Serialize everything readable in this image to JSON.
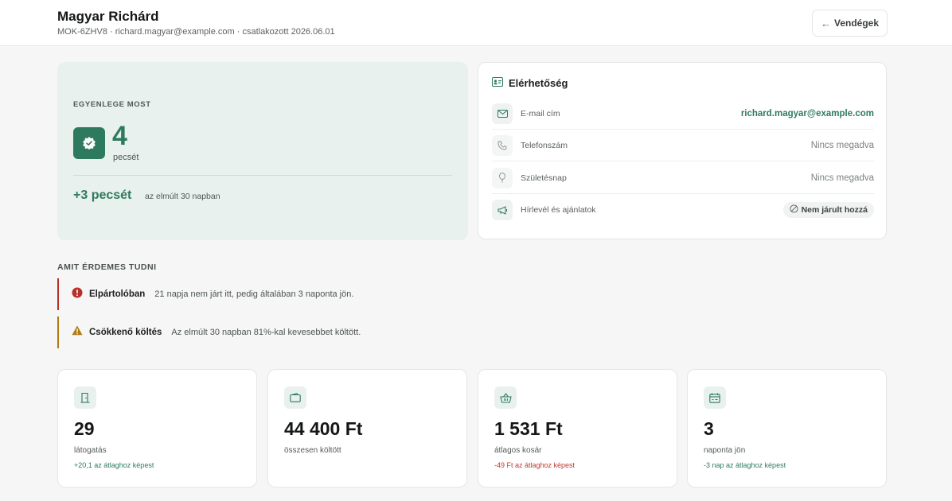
{
  "header": {
    "name": "Magyar Richárd",
    "meta": "MOK-6ZHV8 · richard.magyar@example.com · csatlakozott 2026.06.01",
    "back_label": "Vendégek"
  },
  "balance": {
    "label": "EGYENLEGE MOST",
    "value": "4",
    "unit": "pecsét",
    "gain": "+3 pecsét",
    "gain_note": "az elmúlt 30 napban"
  },
  "contact": {
    "title": "Elérhetőség",
    "rows": [
      {
        "label": "E-mail cím",
        "value": "richard.magyar@example.com",
        "icon": "mail-icon"
      },
      {
        "label": "Telefonszám",
        "value": "Nincs megadva",
        "icon": "phone-icon"
      },
      {
        "label": "Születésnap",
        "value": "Nincs megadva",
        "icon": "balloon-icon"
      },
      {
        "label": "Hírlevél és ajánlatok",
        "value": "Nem járult hozzá",
        "icon": "megaphone-icon"
      }
    ]
  },
  "insights": {
    "label": "AMIT ÉRDEMES TUDNI",
    "items": [
      {
        "title": "Elpártolóban",
        "text": "21 napja nem járt itt, pedig általában 3 naponta jön.",
        "color": "#b8302a"
      },
      {
        "title": "Csökkenő költés",
        "text": "Az elmúlt 30 napban 81%-kal kevesebbet költött.",
        "color": "#b07a14"
      }
    ]
  },
  "kpis": [
    {
      "value": "29",
      "label": "látogatás",
      "note": "+20,1 az átlaghoz képest",
      "trend": "up",
      "icon": "door-icon"
    },
    {
      "value": "44 400 Ft",
      "label": "összesen költött",
      "note": "",
      "trend": "none",
      "icon": "wallet-icon"
    },
    {
      "value": "1 531 Ft",
      "label": "átlagos kosár",
      "note": "-49 Ft az átlaghoz képest",
      "trend": "down",
      "icon": "basket-icon"
    },
    {
      "value": "3",
      "label": "naponta jön",
      "note": "-3 nap az átlaghoz képest",
      "trend": "up",
      "icon": "calendar-icon"
    }
  ],
  "colors": {
    "accent": "#2e7a5e",
    "accent_bg": "#e8f1ed",
    "danger": "#c0392b",
    "warning": "#b07a14"
  }
}
